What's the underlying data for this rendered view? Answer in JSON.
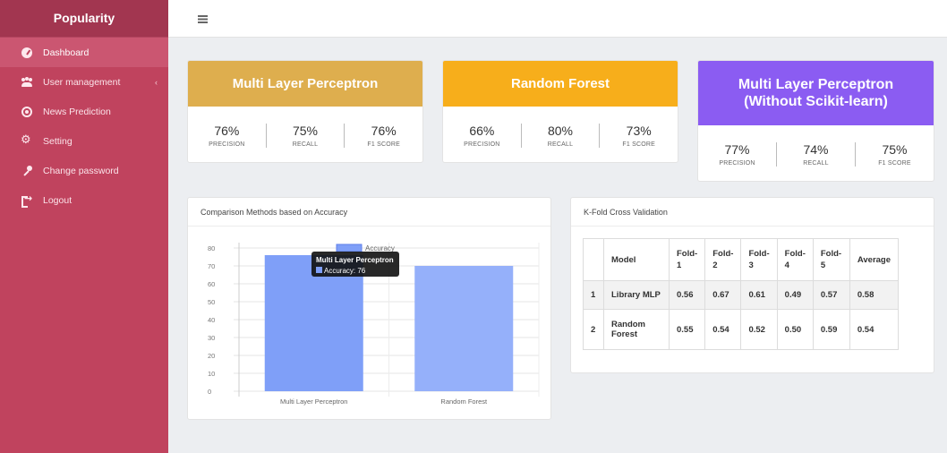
{
  "sidebar": {
    "brand": "Popularity",
    "items": [
      {
        "label": "Dashboard",
        "icon": "dashboard-icon",
        "active": true
      },
      {
        "label": "User management",
        "icon": "users-icon",
        "arrow": "‹"
      },
      {
        "label": "News Prediction",
        "icon": "target-icon"
      },
      {
        "label": "Setting",
        "icon": "gear-icon"
      },
      {
        "label": "Change password",
        "icon": "key-icon"
      },
      {
        "label": "Logout",
        "icon": "logout-icon"
      }
    ]
  },
  "colors": {
    "sidebar": "#c0435e",
    "mlp_card": "#deae4e",
    "rf_card": "#f7ae1b",
    "mlp_noscikit_card": "#8b5cf2",
    "bar": "#7f9ff8"
  },
  "cards": [
    {
      "title": "Multi Layer Perceptron",
      "precision": "76%",
      "recall": "75%",
      "f1": "76%"
    },
    {
      "title": "Random Forest",
      "precision": "66%",
      "recall": "80%",
      "f1": "73%"
    },
    {
      "title_line1": "Multi Layer Perceptron",
      "title_line2": "(Without Scikit-learn)",
      "precision": "77%",
      "recall": "74%",
      "f1": "75%"
    }
  ],
  "metric_labels": {
    "precision": "PRECISION",
    "recall": "RECALL",
    "f1": "F1 SCORE"
  },
  "accuracy_panel": {
    "title": "Comparison Methods based on Accuracy",
    "tooltip": {
      "title": "Multi Layer Perceptron",
      "text": "Accuracy: 76"
    }
  },
  "chart_data": {
    "type": "bar",
    "categories": [
      "Multi Layer Perceptron",
      "Random Forest"
    ],
    "series": [
      {
        "name": "Accuracy",
        "values": [
          76,
          70
        ]
      }
    ],
    "yticks": [
      0,
      10,
      20,
      30,
      40,
      50,
      60,
      70,
      80
    ],
    "ylim": [
      0,
      85
    ],
    "grid": true,
    "legend": "top"
  },
  "kfold_panel": {
    "title": "K-Fold Cross Validation",
    "headers": [
      "",
      "Model",
      "Fold-\n1",
      "Fold-\n2",
      "Fold-\n3",
      "Fold-\n4",
      "Fold-\n5",
      "Average"
    ],
    "rows": [
      [
        "1",
        "Library MLP",
        "0.56",
        "0.67",
        "0.61",
        "0.49",
        "0.57",
        "0.58"
      ],
      [
        "2",
        "Random\nForest",
        "0.55",
        "0.54",
        "0.52",
        "0.50",
        "0.59",
        "0.54"
      ]
    ]
  }
}
